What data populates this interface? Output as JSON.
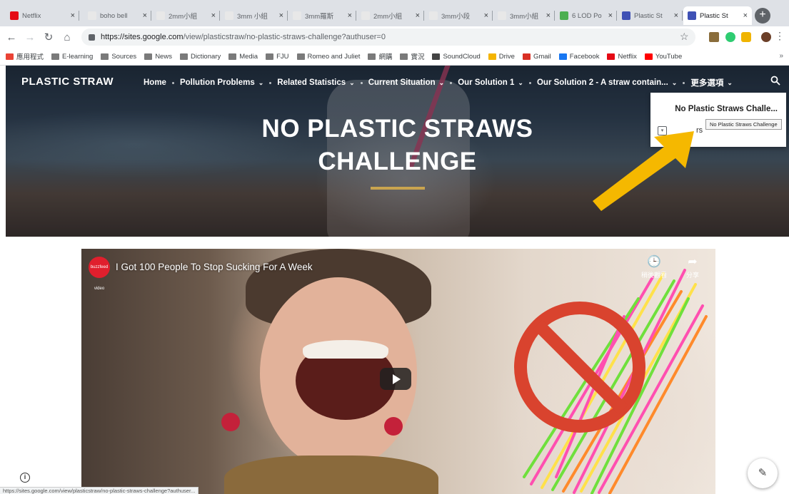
{
  "browser": {
    "tabs": [
      {
        "title": "Netflix",
        "color": "#e50914"
      },
      {
        "title": "boho bell",
        "color": "#e8e8e8"
      },
      {
        "title": "2mm小組",
        "color": "#e8e8e8"
      },
      {
        "title": "3mm 小組",
        "color": "#e8e8e8"
      },
      {
        "title": "3mm羅斯",
        "color": "#e8e8e8"
      },
      {
        "title": "2mm小組",
        "color": "#e8e8e8"
      },
      {
        "title": "3mm小段",
        "color": "#e8e8e8"
      },
      {
        "title": "3mm小組",
        "color": "#e8e8e8"
      },
      {
        "title": "6 LOD Po",
        "color": "#4caf50"
      },
      {
        "title": "Plastic St",
        "color": "#3f51b5"
      },
      {
        "title": "Plastic St",
        "color": "#3f51b5"
      }
    ],
    "tab_close_glyph": "×",
    "new_tab_glyph": "+",
    "url_host": "https://sites.google.com",
    "url_path": "/view/plasticstraw/no-plastic-straws-challenge?authuser=0",
    "bookmarks": [
      {
        "label": "應用程式",
        "icon": "apps-icon"
      },
      {
        "label": "E-learning",
        "icon": "folder-icon"
      },
      {
        "label": "Sources",
        "icon": "folder-icon"
      },
      {
        "label": "News",
        "icon": "folder-icon"
      },
      {
        "label": "Dictionary",
        "icon": "folder-icon"
      },
      {
        "label": "Media",
        "icon": "folder-icon"
      },
      {
        "label": "FJU",
        "icon": "folder-icon"
      },
      {
        "label": "Romeo and Juliet",
        "icon": "folder-icon"
      },
      {
        "label": "網購",
        "icon": "folder-icon"
      },
      {
        "label": "實況",
        "icon": "folder-icon"
      },
      {
        "label": "SoundCloud",
        "icon": "soundcloud-icon"
      },
      {
        "label": "Drive",
        "icon": "drive-icon"
      },
      {
        "label": "Gmail",
        "icon": "gmail-icon"
      },
      {
        "label": "Facebook",
        "icon": "facebook-icon"
      },
      {
        "label": "Netflix",
        "icon": "netflix-icon"
      },
      {
        "label": "YouTube",
        "icon": "youtube-icon"
      }
    ],
    "bookmarks_overflow": "»",
    "status_url": "https://sites.google.com/view/plasticstraw/no-plastic-straws-challenge?authuser..."
  },
  "site": {
    "logo": "PLASTIC STRAW",
    "nav": [
      {
        "label": "Home",
        "dropdown": false
      },
      {
        "label": "Pollution Problems",
        "dropdown": true
      },
      {
        "label": "Related Statistics",
        "dropdown": true
      },
      {
        "label": "Current Situation",
        "dropdown": true
      },
      {
        "label": "Our Solution 1",
        "dropdown": true
      },
      {
        "label": "Our Solution 2 - A straw contain...",
        "dropdown": true
      },
      {
        "label": "更多選項",
        "dropdown": true
      }
    ],
    "chevron_glyph": "⌄",
    "page_title": "NO PLASTIC STRAWS CHALLENGE",
    "dropdown": {
      "item": "No Plastic Straws Challe...",
      "expand_glyph": "▾",
      "partial_label": "rs"
    },
    "tooltip": "No Plastic Straws Challenge"
  },
  "video": {
    "channel": "buzzfeed video",
    "title": "I Got 100 People To Stop Sucking For A Week",
    "watch_later_glyph": "🕒",
    "watch_later_label": "稍後觀看",
    "share_glyph": "➦",
    "share_label": "分享"
  },
  "misc": {
    "info_glyph": "i",
    "edit_glyph": "✎"
  },
  "colors": {
    "accent_gold": "#c9a44f",
    "arrow": "#f5b800",
    "no_sign": "#d9432e"
  }
}
